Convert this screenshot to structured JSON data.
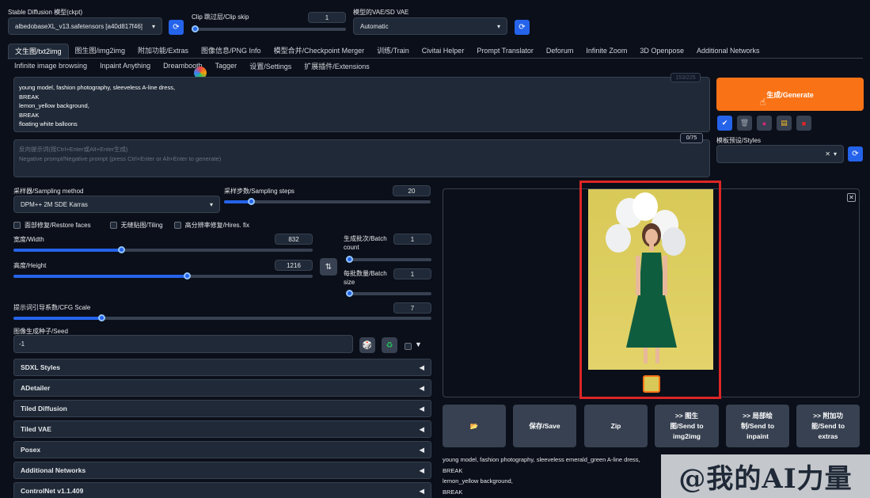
{
  "top": {
    "ckpt_label": "Stable Diffusion 模型(ckpt)",
    "ckpt_value": "albedobaseXL_v13.safetensors [a40d817f46]",
    "clip_label": "Clip 跳过层/Clip skip",
    "clip_value": "1",
    "vae_label": "模型的VAE/SD VAE",
    "vae_value": "Automatic"
  },
  "tabs_row1": [
    "文生图/txt2img",
    "图生图/img2img",
    "附加功能/Extras",
    "图像信息/PNG Info",
    "模型合并/Checkpoint Merger",
    "训练/Train",
    "Civitai Helper",
    "Prompt Translator",
    "Deforum",
    "Infinite Zoom",
    "3D Openpose",
    "Additional Networks"
  ],
  "tabs_row2": [
    "Infinite image browsing",
    "Inpaint Anything",
    "Dreambooth",
    "Tagger",
    "设置/Settings",
    "扩展插件/Extensions"
  ],
  "prompt": {
    "lines": [
      "young model, fashion photography, sleeveless A-line dress,",
      "BREAK",
      "lemon_yellow background,",
      "BREAK",
      "floating white balloons"
    ],
    "token_count": "153/225",
    "neg_placeholder_1": "反向提示词(按Ctrl+Enter或Alt+Enter生成)",
    "neg_placeholder_2": "Negative prompt/Negative prompt (press Ctrl+Enter or Alt+Enter to generate)",
    "neg_token_count": "0/75"
  },
  "generate_label": "生成/Generate",
  "styles_label": "模板预设/Styles",
  "sampler": {
    "method_label": "采样器/Sampling method",
    "method_value": "DPM++ 2M SDE Karras",
    "steps_label": "采样步数/Sampling steps",
    "steps_value": "20",
    "steps_fraction": 0.13
  },
  "checks": {
    "restore_faces": "面部修复/Restore faces",
    "tiling": "无缝贴图/Tiling",
    "hires": "高分辨率修复/Hires. fix"
  },
  "width": {
    "label": "宽度/Width",
    "value": "832",
    "fraction": 0.36
  },
  "height": {
    "label": "高度/Height",
    "value": "1216",
    "fraction": 0.58
  },
  "batch_count": {
    "label1": "生成批次/Batch",
    "label2": "count",
    "value": "1",
    "fraction": 0.0
  },
  "batch_size": {
    "label1": "每批数量/Batch",
    "label2": "size",
    "value": "1",
    "fraction": 0.0
  },
  "cfg": {
    "label": "提示词引导系数/CFG Scale",
    "value": "7",
    "fraction": 0.21
  },
  "seed": {
    "label": "图像生成种子/Seed",
    "value": "-1"
  },
  "accordions": [
    "SDXL Styles",
    "ADetailer",
    "Tiled Diffusion",
    "Tiled VAE",
    "Posex",
    "Additional Networks",
    "ControlNet v1.1.409"
  ],
  "actions": {
    "folder": "📂",
    "save": "保存/Save",
    "zip": "Zip",
    "img2img_1": ">> 图生",
    "img2img_2": "图/Send to",
    "img2img_3": "img2img",
    "inpaint_1": ">> 局部绘",
    "inpaint_2": "制/Send to",
    "inpaint_3": "inpaint",
    "extras_1": ">> 附加功",
    "extras_2": "能/Send to",
    "extras_3": "extras"
  },
  "output_text": [
    "young model, fashion photography, sleeveless emerald_green A-line dress,",
    "BREAK",
    "lemon_yellow background,",
    "BREAK"
  ],
  "watermark": "@我的AI力量",
  "colors": {
    "accent": "#2563eb",
    "generate": "#f97316",
    "highlight": "#dc2626",
    "bg": "#0b0f19"
  }
}
